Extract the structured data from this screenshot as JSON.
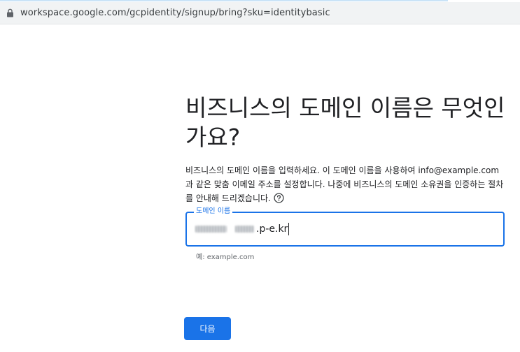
{
  "browser": {
    "url": "workspace.google.com/gcpidentity/signup/bring?sku=identitybasic"
  },
  "page": {
    "title": "비즈니스의 도메인 이름은 무엇인가요?",
    "description": "비즈니스의 도메인 이름을 입력하세요. 이 도메인 이름을 사용하여 info@example.com과 같은 맞춤 이메일 주소를 설정합니다. 나중에 비즈니스의 도메인 소유권을 인증하는 절차를 안내해 드리겠습니다.",
    "help_icon": "help-circle-icon"
  },
  "domain_field": {
    "label": "도메인 이름",
    "visible_value_suffix": ".p-e.kr",
    "hint": "예: example.com"
  },
  "actions": {
    "next_label": "다음"
  },
  "colors": {
    "accent": "#1a73e8",
    "text": "#202124",
    "muted": "#5f6368"
  }
}
